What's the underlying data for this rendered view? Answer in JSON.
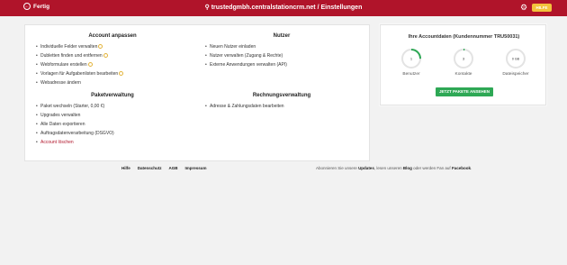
{
  "topbar": {
    "done_label": "Fertig",
    "title": "trustedgmbh.centralstationcrm.net / Einstellungen",
    "help_label": "HILFE"
  },
  "sections": {
    "account": {
      "heading": "Account anpassen",
      "items": [
        {
          "label": "Individuelle Felder verwalten"
        },
        {
          "label": "Dubletten finden und entfernen"
        },
        {
          "label": "Webformulare erstellen"
        },
        {
          "label": "Vorlagen für Aufgabenlisten bearbeiten"
        },
        {
          "label": "Webadresse ändern"
        }
      ]
    },
    "users": {
      "heading": "Nutzer",
      "items": [
        {
          "label": "Neuen Nutzer einladen"
        },
        {
          "label": "Nutzer verwalten (Zugang & Rechte)"
        },
        {
          "label": "Externe Anwendungen verwalten (API)"
        }
      ]
    },
    "package": {
      "heading": "Paketverwaltung",
      "items": [
        {
          "label": "Paket wechseln (Starter, 0,00 €)"
        },
        {
          "label": "Upgrades verwalten"
        },
        {
          "label": "Alle Daten exportieren"
        },
        {
          "label": "Auftragsdatenverarbeitung (DSGVO)"
        },
        {
          "label": "Account löschen"
        }
      ]
    },
    "billing": {
      "heading": "Rechnungsverwaltung",
      "items": [
        {
          "label": "Adresse & Zahlungsdaten bearbeiten"
        }
      ]
    }
  },
  "account_panel": {
    "title": "Ihre Accountdaten (Kundennummer TRU50031)",
    "gauges": [
      {
        "value": "1",
        "label": "Benutzer",
        "fill": 0.25
      },
      {
        "value": "3",
        "label": "Kontakte",
        "fill": 0.02
      },
      {
        "value": "0 GB",
        "label": "Dateispeicher",
        "fill": 0.0
      }
    ],
    "cta_label": "JETZT PAKETE ANSEHEN"
  },
  "footer": {
    "links": [
      "Hilfe",
      "Datenschutz",
      "AGB",
      "Impressum"
    ],
    "social_pre": "Abonnieren Sie unsere",
    "updates": "Updates",
    "social_mid": ", lesen unseren",
    "blog": "Blog",
    "social_mid2": "oder werden Fan auf",
    "facebook": "Facebook",
    "social_end": "."
  },
  "colors": {
    "brand": "#b0142a",
    "accent": "#f3c23c",
    "cta": "#2ea855",
    "gauge": "#2ea855"
  }
}
